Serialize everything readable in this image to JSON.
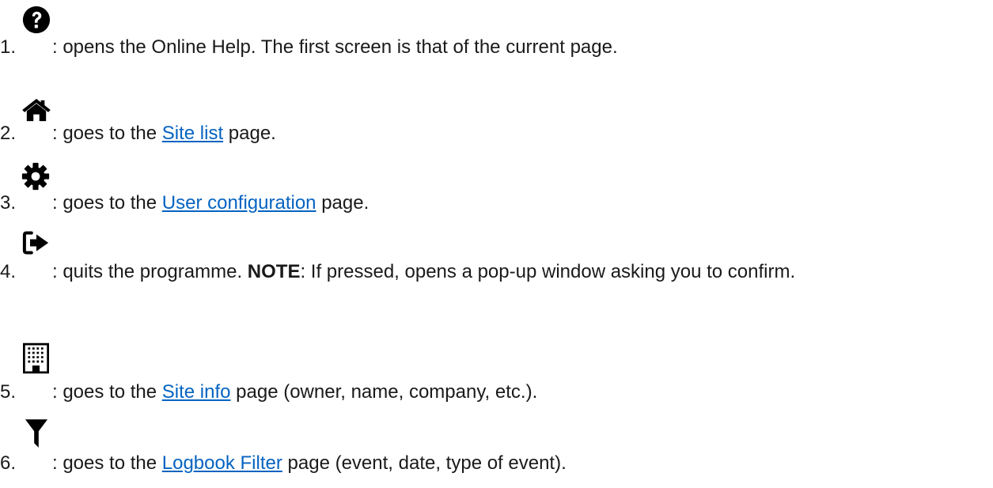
{
  "items": [
    {
      "number": "1.",
      "icon": "question-circle-icon",
      "before": ": opens the Online Help. The first screen is that of the current page."
    },
    {
      "number": "2.",
      "icon": "home-icon",
      "before": ": goes to the ",
      "link": "Site list",
      "after": " page."
    },
    {
      "number": "3.",
      "icon": "gear-icon",
      "before": ": goes to the ",
      "link": "User configuration",
      "after": " page."
    },
    {
      "number": "4.",
      "icon": "sign-out-icon",
      "before": ": quits the programme. ",
      "bold": "NOTE",
      "after": ": If pressed, opens a pop-up window asking you to confirm."
    },
    {
      "number": "5.",
      "icon": "building-icon",
      "before": ": goes to the ",
      "link": "Site info",
      "after": " page (owner, name, company, etc.)."
    },
    {
      "number": "6.",
      "icon": "filter-icon",
      "before": ": goes to the ",
      "link": "Logbook Filter",
      "after": " page (event, date, type of event)."
    }
  ]
}
